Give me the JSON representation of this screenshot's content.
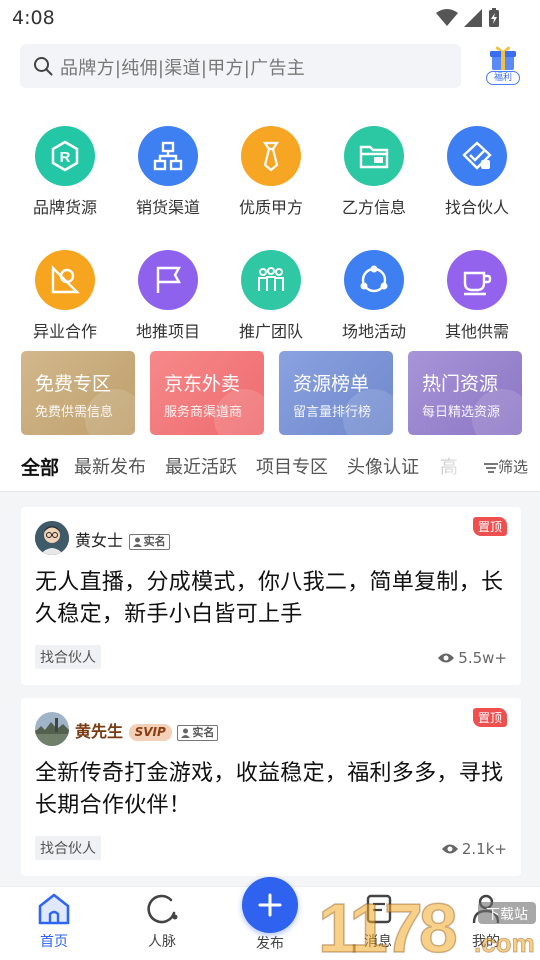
{
  "status_bar": {
    "time": "4:08"
  },
  "search": {
    "placeholder": "品牌方|纯佣|渠道|甲方|广告主"
  },
  "gift": {
    "label": "福利"
  },
  "categories": [
    {
      "label": "品牌货源",
      "icon": "brand-r-icon",
      "color": "#23c7a6"
    },
    {
      "label": "销货渠道",
      "icon": "org-chart-icon",
      "color": "#3e7ff2"
    },
    {
      "label": "优质甲方",
      "icon": "tie-icon",
      "color": "#f6a623"
    },
    {
      "label": "乙方信息",
      "icon": "folder-icon",
      "color": "#2cc7a3"
    },
    {
      "label": "找合伙人",
      "icon": "handshake-icon",
      "color": "#3d7ef3"
    },
    {
      "label": "异业合作",
      "icon": "triangle-ruler-icon",
      "color": "#f7a51f"
    },
    {
      "label": "地推项目",
      "icon": "flag-icon",
      "color": "#8f62ee"
    },
    {
      "label": "推广团队",
      "icon": "team-icon",
      "color": "#30c7a5"
    },
    {
      "label": "场地活动",
      "icon": "share-nodes-icon",
      "color": "#3e7ff2"
    },
    {
      "label": "其他供需",
      "icon": "cup-icon",
      "color": "#9463ee"
    }
  ],
  "promos": [
    {
      "title": "免费专区",
      "subtitle": "免费供需信息",
      "color": "#c9ad7e"
    },
    {
      "title": "京东外卖",
      "subtitle": "服务商渠道商",
      "color": "#f0787a"
    },
    {
      "title": "资源榜单",
      "subtitle": "留言量排行榜",
      "color": "#7d95d6"
    },
    {
      "title": "热门资源",
      "subtitle": "每日精选资源",
      "color": "#9a85cf"
    }
  ],
  "tabs": [
    "全部",
    "最新发布",
    "最近活跃",
    "项目专区",
    "头像认证",
    "高"
  ],
  "filter_label": "筛选",
  "posts": [
    {
      "author": "黄女士",
      "real_name_badge": "实名",
      "pin": "置顶",
      "content": "无人直播，分成模式，你八我二，简单复制，长久稳定，新手小白皆可上手",
      "tag": "找合伙人",
      "views": "5.5w+"
    },
    {
      "author": "黄先生",
      "svip_badge": "SVIP",
      "real_name_badge": "实名",
      "pin": "置顶",
      "content": "全新传奇打金游戏，收益稳定，福利多多，寻找长期合作伙伴！",
      "tag": "找合伙人",
      "views": "2.1k+"
    }
  ],
  "nav": {
    "home": "首页",
    "contacts": "人脉",
    "publish": "发布",
    "messages": "消息",
    "mine": "我的"
  },
  "watermark": {
    "text": "1178",
    "domain": ".com",
    "tag": "下载站"
  },
  "colors": {
    "accent": "#2f62ef",
    "pin": "#ee4f4f"
  }
}
